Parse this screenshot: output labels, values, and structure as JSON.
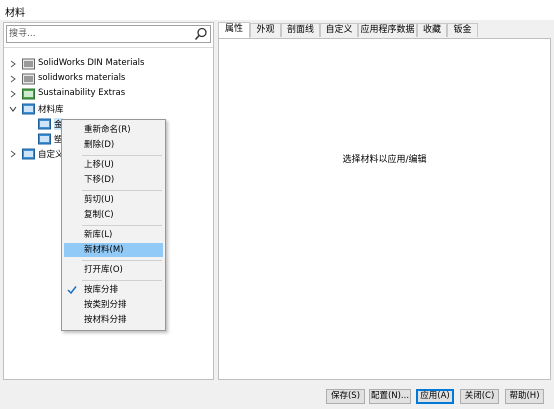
{
  "window": {
    "title": "材料"
  },
  "search": {
    "placeholder": "搜寻..."
  },
  "tree": {
    "items": [
      {
        "label": "SolidWorks DIN Materials"
      },
      {
        "label": "solidworks materials"
      },
      {
        "label": "Sustainability Extras"
      },
      {
        "label": "材料库"
      },
      {
        "label": "金"
      },
      {
        "label": "塑"
      },
      {
        "label": "自定义"
      }
    ]
  },
  "tabs": [
    "属性",
    "外观",
    "剖面线",
    "自定义",
    "应用程序数据",
    "收藏",
    "钣金"
  ],
  "content": {
    "message": "选择材料以应用/编辑"
  },
  "context_menu": {
    "items": [
      "重新命名(R)",
      "删除(D)",
      "上移(U)",
      "下移(D)",
      "剪切(U)",
      "复制(C)",
      "新库(L)",
      "新材料(M)",
      "打开库(O)",
      "按库分排",
      "按类别分排",
      "按材料分排"
    ]
  },
  "buttons": {
    "save": "保存(S)",
    "config": "配置(N)...",
    "apply": "应用(A)",
    "close": "关闭(C)",
    "help": "帮助(H)"
  },
  "colors": {
    "highlight": "#91c9f7",
    "accent": "#0078d7",
    "folder_blue": "#3a8fd6",
    "folder_green": "#4aa64a"
  }
}
